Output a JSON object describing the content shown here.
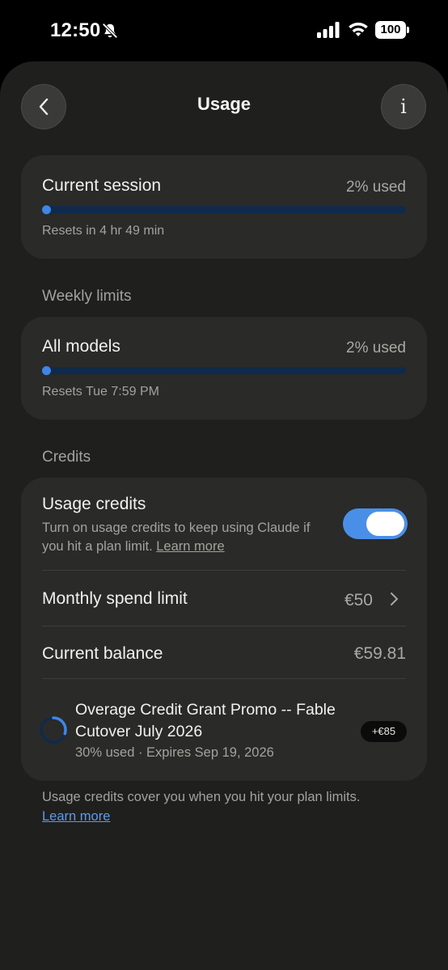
{
  "status_bar": {
    "time": "12:50",
    "battery": "100",
    "icons": [
      "bell-off-icon",
      "signal-icon",
      "wifi-icon",
      "battery-icon"
    ]
  },
  "header": {
    "title": "Usage",
    "back_icon": "chevron-left-icon",
    "info_label": "i"
  },
  "current_session": {
    "title": "Current session",
    "used_label": "2% used",
    "progress_fraction": 0.02,
    "reset_text": "Resets in 4 hr 49 min"
  },
  "weekly": {
    "section_label": "Weekly limits",
    "title": "All models",
    "used_label": "2% used",
    "progress_fraction": 0.02,
    "reset_text": "Resets Tue 7:59 PM"
  },
  "credits": {
    "section_label": "Credits",
    "usage_credits": {
      "title": "Usage credits",
      "description": "Turn on usage credits to keep using Claude if you hit a plan limit.",
      "learn_more": "Learn more",
      "enabled": true
    },
    "monthly_limit": {
      "label": "Monthly spend limit",
      "value": "€50"
    },
    "balance": {
      "label": "Current balance",
      "value": "€59.81"
    },
    "promo": {
      "title": "Overage Credit Grant Promo -- Fable Cutover July 2026",
      "meta": "30% used · Expires Sep 19, 2026",
      "badge": "+€85",
      "used_fraction": 0.3
    }
  },
  "footer": {
    "text": "Usage credits cover you when you hit your plan limits.",
    "link": "Learn more"
  },
  "colors": {
    "accent": "#3f86e8",
    "track": "#102a4c",
    "sheet_bg": "#1f1f1e",
    "card_bg": "#2a2a28",
    "link": "#5b9bef"
  }
}
